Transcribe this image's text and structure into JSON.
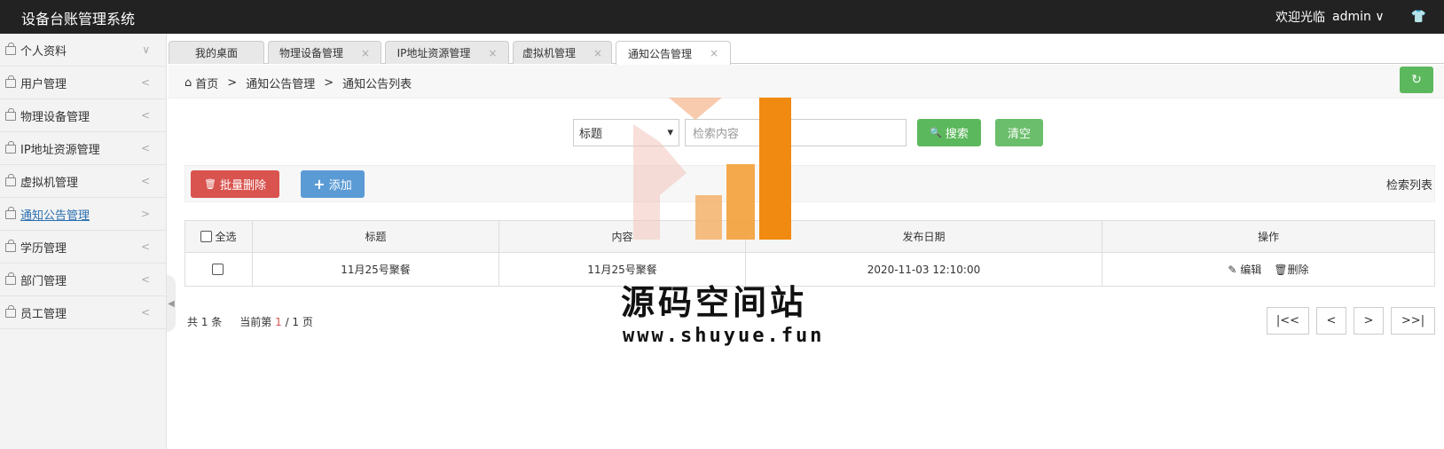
{
  "app": {
    "title": "设备台账管理系统",
    "welcome": "欢迎光临",
    "user": "admin",
    "user_chevron": "∨",
    "shirt_icon": "👕"
  },
  "sidebar": {
    "items": [
      {
        "label": "个人资料",
        "arrow": "∨"
      },
      {
        "label": "用户管理",
        "arrow": "<"
      },
      {
        "label": "物理设备管理",
        "arrow": "<"
      },
      {
        "label": "IP地址资源管理",
        "arrow": "<"
      },
      {
        "label": "虚拟机管理",
        "arrow": "<"
      },
      {
        "label": "通知公告管理",
        "arrow": ">"
      },
      {
        "label": "学历管理",
        "arrow": "<"
      },
      {
        "label": "部门管理",
        "arrow": "<"
      },
      {
        "label": "员工管理",
        "arrow": "<"
      }
    ],
    "collapse_icon": "◀"
  },
  "tabs": [
    {
      "label": "我的桌面",
      "close": ""
    },
    {
      "label": "物理设备管理",
      "close": "×"
    },
    {
      "label": "IP地址资源管理",
      "close": "×"
    },
    {
      "label": "虚拟机管理",
      "close": "×"
    },
    {
      "label": "通知公告管理",
      "close": "×"
    }
  ],
  "breadcrumb": {
    "home_icon": "⌂",
    "home": "首页",
    "sep1": ">",
    "level1": "通知公告管理",
    "sep2": ">",
    "level2": "通知公告列表"
  },
  "refresh_icon": "↻",
  "search": {
    "field": "标题",
    "placeholder": "检索内容",
    "search_icon": "🔍",
    "search_label": "搜索",
    "clear_label": "清空"
  },
  "toolbar": {
    "delete_icon": "🗑",
    "delete_label": "批量删除",
    "add_icon": "+",
    "add_label": "添加",
    "title": "检索列表"
  },
  "table": {
    "headers": [
      "全选",
      "标题",
      "内容",
      "发布日期",
      "操作"
    ],
    "rows": [
      {
        "title": "11月25号聚餐",
        "content": "11月25号聚餐",
        "date": "2020-11-03 12:10:00",
        "edit": "编辑",
        "delete": "删除"
      }
    ]
  },
  "footer": {
    "total": "共 1 条",
    "current": "当前第",
    "page_current": "1",
    "page_total": "/ 1 页"
  },
  "pager": [
    "|<<",
    "<",
    ">",
    ">>|"
  ],
  "watermark": {
    "name": "源码空间站",
    "url": "www.shuyue.fun"
  },
  "colors": {
    "green": "#5cb85c",
    "red": "#d9534f",
    "blue": "#5b9bd5",
    "topbar": "#222222"
  }
}
